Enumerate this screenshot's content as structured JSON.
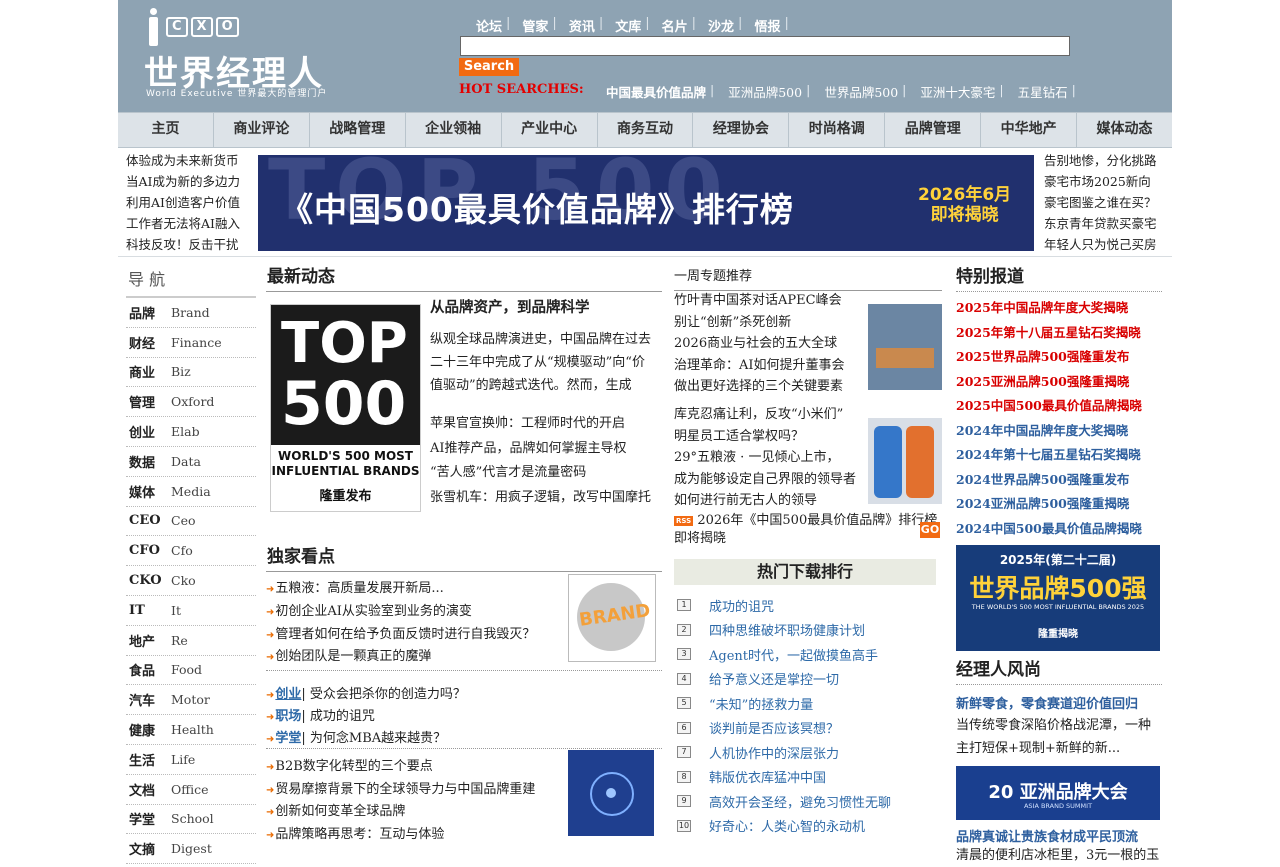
{
  "logo": {
    "cxo": [
      "C",
      "X",
      "O"
    ],
    "cn": "世界经理人",
    "en": "World Executive 世界最大的管理门户"
  },
  "topnav": [
    "论坛",
    "管家",
    "资讯",
    "文库",
    "名片",
    "沙龙",
    "悟报"
  ],
  "search": {
    "value": "",
    "button": "Search"
  },
  "hot": {
    "label": "HOT SEARCHES:",
    "items": [
      "中国最具价值品牌",
      "亚洲品牌500",
      "世界品牌500",
      "亚洲十大豪宅",
      "五星钻石"
    ]
  },
  "mainnav": [
    "主页",
    "商业评论",
    "战略管理",
    "企业领袖",
    "产业中心",
    "商务互动",
    "经理协会",
    "时尚格调",
    "品牌管理",
    "中华地产",
    "媒体动态"
  ],
  "left_news": [
    "体验成为未来新货币",
    "当AI成为新的多边力",
    "利用AI创造客户价值",
    "工作者无法将AI融入",
    "科技反攻！反击干扰"
  ],
  "banner": {
    "title": "《中国500最具价值品牌》排行榜",
    "date_line1": "2026年6月",
    "date_line2": "即将揭晓",
    "ghost": "TOP 500"
  },
  "right_news": [
    "告别地惨，分化挑路",
    "豪宅市场2025新向",
    "豪宅图鉴之谁在买？",
    "东京青年贷款买豪宅",
    "年轻人只为悦己买房"
  ],
  "sidebar": {
    "title": "导 航",
    "items": [
      {
        "cn": "品牌",
        "en": "Brand"
      },
      {
        "cn": "财经",
        "en": "Finance"
      },
      {
        "cn": "商业",
        "en": "Biz"
      },
      {
        "cn": "管理",
        "en": "Oxford"
      },
      {
        "cn": "创业",
        "en": "Elab"
      },
      {
        "cn": "数据",
        "en": "Data"
      },
      {
        "cn": "媒体",
        "en": "Media"
      },
      {
        "cn": "CEO",
        "en": "Ceo"
      },
      {
        "cn": "CFO",
        "en": "Cfo"
      },
      {
        "cn": "CKO",
        "en": "Cko"
      },
      {
        "cn": "IT",
        "en": "It"
      },
      {
        "cn": "地产",
        "en": "Re"
      },
      {
        "cn": "食品",
        "en": "Food"
      },
      {
        "cn": "汽车",
        "en": "Motor"
      },
      {
        "cn": "健康",
        "en": "Health"
      },
      {
        "cn": "生活",
        "en": "Life"
      },
      {
        "cn": "文档",
        "en": "Office"
      },
      {
        "cn": "学堂",
        "en": "School"
      },
      {
        "cn": "文摘",
        "en": "Digest"
      }
    ]
  },
  "latest": {
    "heading": "最新动态",
    "img": {
      "line1": "TOP",
      "line2": "500",
      "caption": "WORLD'S 500 MOST INFLUENTIAL BRANDS",
      "tag": "隆重发布"
    },
    "title": "从品牌资产，到品牌科学",
    "summary": "纵观全球品牌演进史，中国品牌在过去二十三年中完成了从“规模驱动”向“价值驱动”的跨越式迭代。然而，生成式...",
    "links": [
      "苹果官宣换帅：工程师时代的开启",
      "AI推荐产品，品牌如何掌握主导权",
      "“苦人感”代言才是流量密码",
      "张雪机车：用疯子逻辑，改写中国摩托"
    ]
  },
  "exclusive": {
    "heading": "独家看点",
    "list1": [
      "五粮液：高质量发展开新局...",
      "初创企业AI从实验室到业务的演变",
      "管理者如何在给予负面反馈时进行自我毁灭？",
      "创始团队是一颗真正的魔弹"
    ],
    "img_text": "BRAND",
    "tagged": [
      {
        "tag": "创业",
        "text": "| 受众会把杀你的创造力吗？"
      },
      {
        "tag": "职场",
        "text": "| 成功的诅咒"
      },
      {
        "tag": "学堂",
        "text": "| 为何念MBA越来越贵？"
      }
    ],
    "list2": [
      "B2B数字化转型的三个要点",
      "贸易摩擦背景下的全球领导力与中国品牌重建",
      "创新如何变革全球品牌",
      "品牌策略再思考：互动与体验"
    ]
  },
  "weekly": {
    "heading": "一周专题推荐",
    "list1": [
      "竹叶青中国茶对话APEC峰会",
      "别让“创新”杀死创新",
      "2026商业与社会的五大全球",
      "治理革命：AI如何提升董事会",
      "做出更好选择的三个关键要素"
    ],
    "list2": [
      "库克忍痛让利，反攻“小米们”",
      "明星员工适合掌权吗？",
      "29°五粮液 · 一见倾心上市，",
      "成为能够设定自己界限的领导者",
      "如何进行前无古人的领导"
    ],
    "rss_label": "RSS",
    "rss_text": "2026年《中国500最具价值品牌》排行榜即将揭晓",
    "go": "GO"
  },
  "downloads": {
    "heading": "热门下载排行",
    "items": [
      "成功的诅咒",
      "四种思维破坏职场健康计划",
      "Agent时代，一起做摸鱼高手",
      "给予意义还是掌控一切",
      "“未知”的拯救力量",
      "谈判前是否应该冥想？",
      "人机协作中的深层张力",
      "韩版优衣库猛冲中国",
      "高效开会圣经，避免习惯性无聊",
      "好奇心：人类心智的永动机"
    ]
  },
  "special": {
    "heading": "特别报道",
    "red": [
      "2025年中国品牌年度大奖揭晓",
      "2025年第十八届五星钻石奖揭晓",
      "2025世界品牌500强隆重发布",
      "2025亚洲品牌500强隆重揭晓",
      "2025中国500最具价值品牌揭晓"
    ],
    "blue": [
      "2024年中国品牌年度大奖揭晓",
      "2024年第十七届五星钻石奖揭晓",
      "2024世界品牌500强隆重发布",
      "2024亚洲品牌500强隆重揭晓",
      "2024中国500最具价值品牌揭晓"
    ],
    "img": {
      "year": "2025年(第二十二届)",
      "title": "世界品牌500强",
      "en": "THE WORLD'S 500 MOST INFLUENTIAL BRANDS 2025",
      "tag": "隆重揭晓"
    }
  },
  "style": {
    "heading": "经理人风尚",
    "title1": "新鲜零食，零食赛道迎价值回归",
    "text1": "当传统零食深陷价格战泥潭，一种主打短保+现制+新鲜的新...",
    "img": {
      "title": "20 亚洲品牌大会",
      "en": "ASIA BRAND SUMMIT"
    },
    "title2": "品牌真诚让贵族食材成平民顶流",
    "text2": "清晨的便利店冰柜里，3元一根的玉"
  },
  "colors": {
    "header": "#8ea3b3",
    "accent": "#f26a12",
    "hot": "#e30000",
    "link_blue": "#2e5f9e",
    "special_red": "#d80000"
  }
}
